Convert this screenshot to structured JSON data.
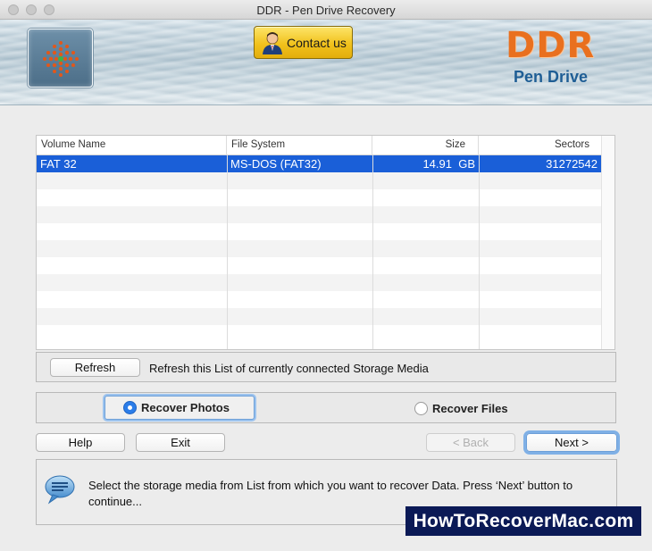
{
  "window": {
    "title": "DDR - Pen Drive Recovery"
  },
  "header": {
    "contact_label": "Contact us",
    "brand_title": "DDR",
    "brand_subtitle": "Pen Drive",
    "colors": {
      "brand_orange": "#e9701f",
      "brand_blue": "#1f5e95",
      "contact_gold": "#f1c21d"
    }
  },
  "table": {
    "columns": [
      "Volume Name",
      "File System",
      "Size",
      "Sectors"
    ],
    "rows": [
      {
        "volume_name": "FAT 32",
        "file_system": "MS-DOS (FAT32)",
        "size": "14.91  GB",
        "sectors": "31272542",
        "selected": true
      }
    ],
    "selection_color": "#1a5fd8"
  },
  "refresh": {
    "button_label": "Refresh",
    "description": "Refresh this List of currently connected Storage Media"
  },
  "recovery_mode": {
    "options": [
      {
        "label": "Recover Photos",
        "selected": true
      },
      {
        "label": "Recover Files",
        "selected": false
      }
    ]
  },
  "actions": {
    "help_label": "Help",
    "exit_label": "Exit",
    "back_label": "< Back",
    "next_label": "Next >"
  },
  "info": {
    "message": "Select the storage media from List from which you want to recover Data. Press ‘Next’ button to continue..."
  },
  "watermark": {
    "text": "HowToRecoverMac.com"
  },
  "icons": [
    "ddr-logo-icon",
    "contact-person-icon",
    "speech-bubble-icon"
  ]
}
